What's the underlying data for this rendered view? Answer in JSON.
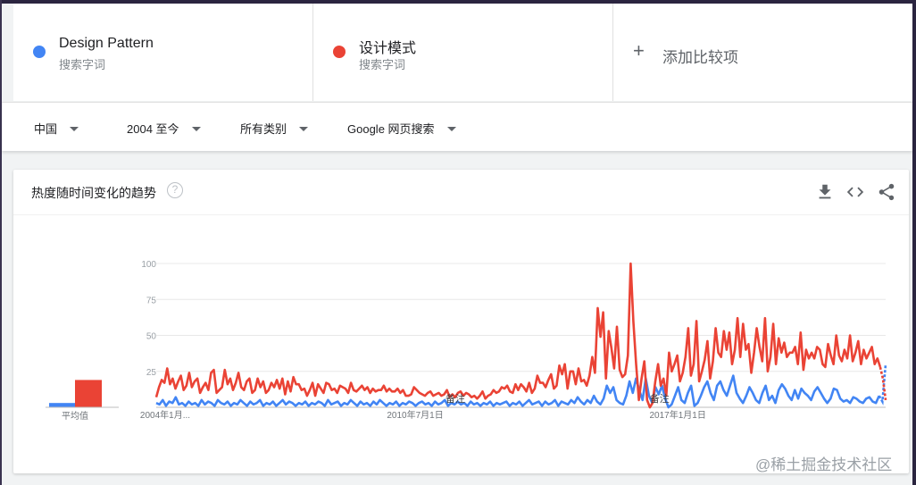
{
  "terms": [
    {
      "name": "Design Pattern",
      "sub": "搜索字词",
      "color": "#4285f4"
    },
    {
      "name": "设计模式",
      "sub": "搜索字词",
      "color": "#ea4335"
    }
  ],
  "add_compare": {
    "plus": "+",
    "label": "添加比较项"
  },
  "filters": [
    {
      "label": "中国"
    },
    {
      "label": "2004 至今"
    },
    {
      "label": "所有类别"
    },
    {
      "label": "Google 网页搜索"
    }
  ],
  "card": {
    "title": "热度随时间变化的趋势",
    "help": "?"
  },
  "watermark": "@稀土掘金技术社区",
  "chart_data": {
    "type": "line",
    "title": "热度随时间变化的趋势",
    "x_tick_labels": [
      "2004年1月...",
      "2010年7月1日",
      "2017年1月1日"
    ],
    "y_ticks": [
      25,
      50,
      75,
      100
    ],
    "ylim": [
      0,
      100
    ],
    "grid": true,
    "legend": "top",
    "annotations": [
      "备注",
      "备注"
    ],
    "average_label": "平均值",
    "averages": [
      {
        "name": "Design Pattern",
        "value": 3
      },
      {
        "name": "设计模式",
        "value": 19
      }
    ],
    "series": [
      {
        "name": "Design Pattern",
        "color": "#4285f4",
        "dashed_tail": true,
        "values": [
          3,
          2,
          5,
          1,
          4,
          3,
          7,
          2,
          3,
          1,
          4,
          2,
          3,
          1,
          5,
          2,
          4,
          3,
          1,
          5,
          3,
          2,
          4,
          1,
          3,
          2,
          5,
          3,
          1,
          4,
          2,
          3,
          5,
          1,
          3,
          2,
          4,
          1,
          3,
          5,
          2,
          4,
          3,
          1,
          3,
          2,
          4,
          1,
          3,
          2,
          4,
          3,
          1,
          5,
          2,
          3,
          4,
          1,
          3,
          2,
          5,
          3,
          1,
          4,
          2,
          3,
          1,
          4,
          2,
          5,
          3,
          1,
          3,
          2,
          4,
          1,
          3,
          2,
          4,
          3,
          1,
          3,
          4,
          2,
          3,
          1,
          4,
          2,
          3,
          5,
          1,
          3,
          2,
          4,
          2,
          3,
          1,
          4,
          2,
          3,
          1,
          3,
          2,
          4,
          1,
          3,
          2,
          3,
          4,
          1,
          3,
          2,
          4,
          1,
          3,
          5,
          2,
          3,
          4,
          1,
          4,
          2,
          3,
          5,
          1,
          4,
          3,
          2,
          5,
          3,
          7,
          4,
          2,
          5,
          3,
          8,
          4,
          2,
          6,
          15,
          10,
          14,
          5,
          3,
          2,
          8,
          18,
          10,
          20,
          12,
          5,
          20,
          8,
          3,
          14,
          9,
          15,
          6,
          0,
          2,
          8,
          14,
          5,
          3,
          10,
          15,
          1,
          3,
          8,
          14,
          18,
          10,
          5,
          15,
          18,
          12,
          8,
          15,
          22,
          10,
          6,
          3,
          8,
          14,
          10,
          5,
          3,
          10,
          15,
          5,
          8,
          3,
          12,
          16,
          13,
          8,
          5,
          12,
          6,
          13,
          10,
          8,
          5,
          11,
          14,
          10,
          6,
          3,
          6,
          13,
          12,
          6,
          4,
          5,
          3,
          7,
          6,
          4,
          3,
          6,
          7,
          4,
          3,
          8,
          4,
          30
        ]
      },
      {
        "name": "设计模式",
        "color": "#ea4335",
        "dashed_tail": true,
        "values": [
          7,
          14,
          19,
          17,
          27,
          16,
          20,
          13,
          18,
          22,
          12,
          15,
          24,
          14,
          18,
          20,
          10,
          14,
          17,
          12,
          24,
          26,
          10,
          12,
          14,
          26,
          16,
          20,
          12,
          17,
          24,
          14,
          12,
          18,
          20,
          10,
          12,
          20,
          14,
          18,
          10,
          12,
          17,
          14,
          19,
          13,
          20,
          9,
          18,
          11,
          21,
          16,
          16,
          12,
          13,
          8,
          12,
          17,
          8,
          16,
          13,
          10,
          17,
          16,
          12,
          13,
          10,
          15,
          14,
          13,
          10,
          17,
          12,
          11,
          13,
          15,
          12,
          14,
          10,
          13,
          11,
          12,
          12,
          15,
          11,
          13,
          11,
          11,
          13,
          10,
          12,
          8,
          8,
          9,
          14,
          12,
          10,
          9,
          8,
          10,
          11,
          8,
          9,
          10,
          8,
          9,
          12,
          7,
          9,
          7,
          10,
          11,
          8,
          10,
          9,
          7,
          8,
          6,
          8,
          11,
          6,
          8,
          9,
          12,
          10,
          11,
          14,
          13,
          15,
          11,
          10,
          16,
          12,
          16,
          14,
          11,
          17,
          10,
          13,
          22,
          17,
          17,
          14,
          19,
          23,
          13,
          15,
          29,
          23,
          30,
          13,
          25,
          25,
          16,
          27,
          18,
          19,
          15,
          22,
          35,
          24,
          69,
          49,
          66,
          20,
          53,
          41,
          27,
          56,
          26,
          21,
          23,
          36,
          100,
          60,
          30,
          5,
          20,
          32,
          5,
          0,
          3,
          18,
          30,
          15,
          20,
          8,
          38,
          25,
          30,
          36,
          18,
          24,
          35,
          55,
          22,
          30,
          60,
          18,
          25,
          33,
          46,
          20,
          32,
          55,
          38,
          35,
          53,
          40,
          52,
          30,
          40,
          62,
          35,
          58,
          40,
          44,
          24,
          38,
          55,
          42,
          32,
          62,
          25,
          35,
          58,
          30,
          48,
          38,
          45,
          35,
          38,
          38,
          42,
          30,
          52,
          26,
          40,
          34,
          38,
          34,
          42,
          40,
          30,
          28,
          44,
          36,
          30,
          50,
          36,
          32,
          40,
          34,
          50,
          32,
          38,
          46,
          30,
          40,
          34,
          38,
          42,
          30,
          34,
          28,
          20,
          5
        ]
      }
    ]
  }
}
